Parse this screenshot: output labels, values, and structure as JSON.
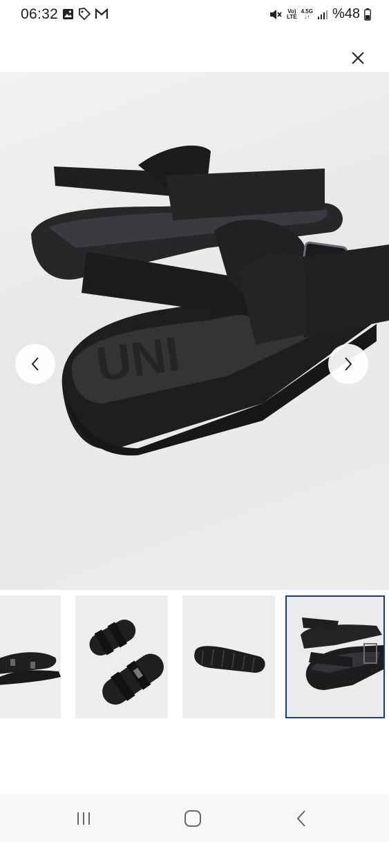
{
  "status_bar": {
    "time": "06:32",
    "network_top": "Vo)",
    "network_bottom": "LTE",
    "speed_top": "4.5G",
    "speed_bottom": "↓↑",
    "battery": "%48",
    "icons": [
      "image-icon",
      "tag-icon",
      "gmail-icon",
      "mute-icon",
      "signal-icon",
      "battery-icon"
    ]
  },
  "viewer": {
    "close_icon": "close-icon",
    "prev_icon": "chevron-left-icon",
    "next_icon": "chevron-right-icon",
    "main_image_alt": "black sandal rear view",
    "thumbnails": [
      {
        "icon": "sandal-pair-side-image",
        "selected": false
      },
      {
        "icon": "sandal-pair-top-image",
        "selected": false
      },
      {
        "icon": "sandal-sole-image",
        "selected": false
      },
      {
        "icon": "sandal-rear-image",
        "selected": true
      }
    ]
  },
  "system_nav": {
    "icons": [
      "recent-apps-icon",
      "home-icon",
      "back-icon"
    ]
  },
  "colors": {
    "accent": "#1d3a8a",
    "sandal": "#1e1f21",
    "background": "#ececee"
  }
}
